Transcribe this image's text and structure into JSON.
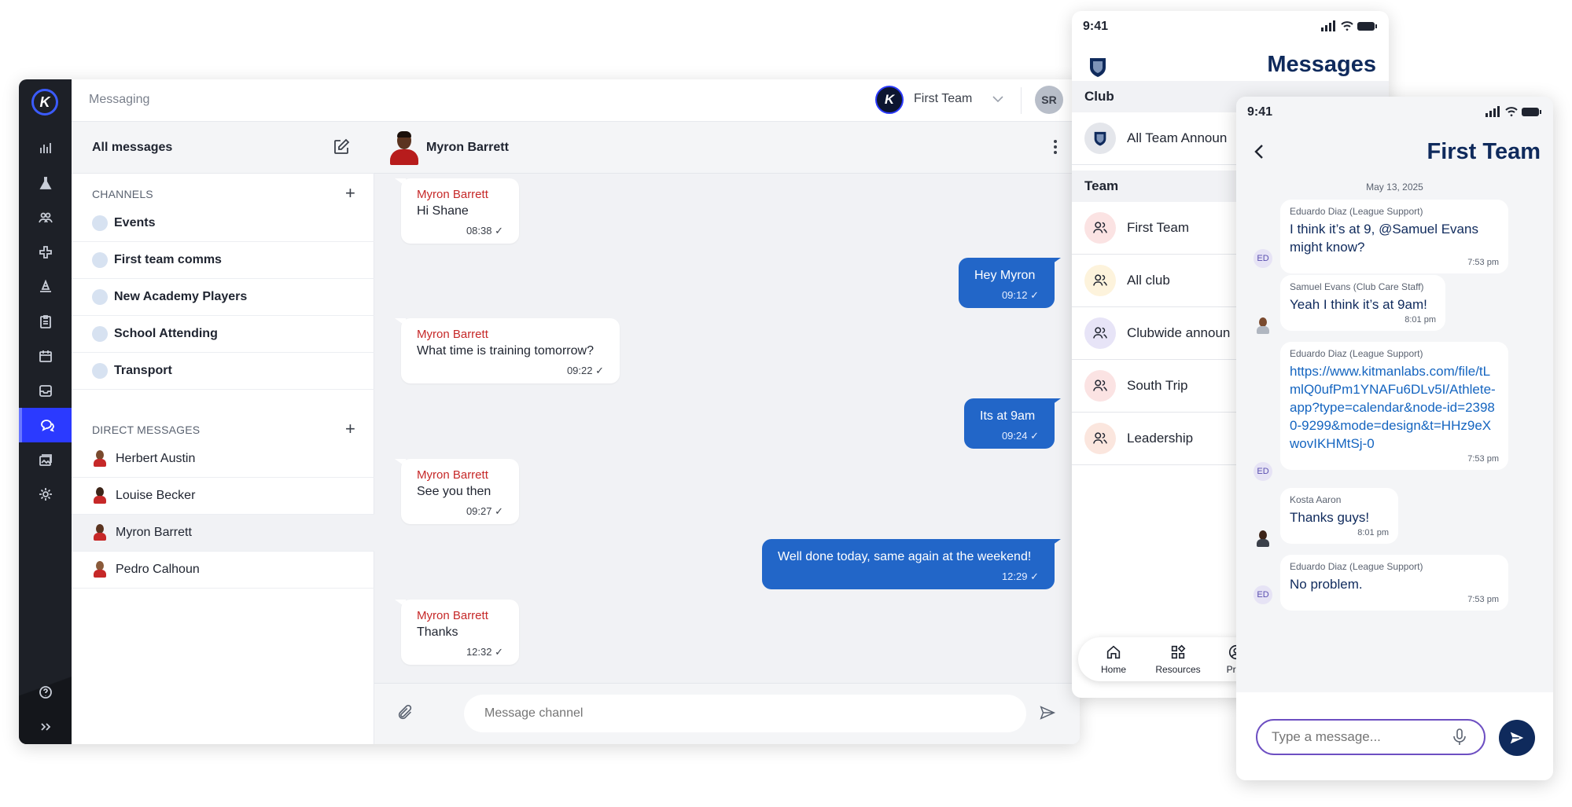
{
  "desktop": {
    "topbar": {
      "title": "Messaging",
      "team_name": "First Team",
      "user_initials": "SR",
      "team_logo_letter": "K"
    },
    "rail_logo_letter": "K",
    "sidebar": {
      "all_messages_label": "All messages",
      "channels_heading": "CHANNELS",
      "channels": [
        {
          "label": "Events"
        },
        {
          "label": "First team comms"
        },
        {
          "label": "New Academy Players"
        },
        {
          "label": "School Attending"
        },
        {
          "label": "Transport"
        }
      ],
      "direct_heading": "DIRECT MESSAGES",
      "direct": [
        {
          "label": "Herbert Austin"
        },
        {
          "label": "Louise Becker"
        },
        {
          "label": "Myron Barrett"
        },
        {
          "label": "Pedro Calhoun"
        }
      ]
    },
    "chat": {
      "contact_name": "Myron Barrett",
      "messages": [
        {
          "dir": "in",
          "sender": "Myron Barrett",
          "text": "Hi Shane",
          "time": "08:38 ✓"
        },
        {
          "dir": "out",
          "text": "Hey Myron",
          "time": "09:12 ✓"
        },
        {
          "dir": "in",
          "sender": "Myron Barrett",
          "text": "What time is training tomorrow?",
          "time": "09:22 ✓"
        },
        {
          "dir": "out",
          "text": "Its at 9am",
          "time": "09:24 ✓"
        },
        {
          "dir": "in",
          "sender": "Myron Barrett",
          "text": "See you then",
          "time": "09:27 ✓"
        },
        {
          "dir": "out",
          "text": "Well done today, same again at the weekend!",
          "time": "12:29 ✓"
        },
        {
          "dir": "in",
          "sender": "Myron Barrett",
          "text": "Thanks",
          "time": "12:32 ✓"
        }
      ],
      "composer_placeholder": "Message channel"
    },
    "colors": {
      "accent": "#2b3aff",
      "outgoing_bubble": "#2266c8",
      "sender_name": "#c62828"
    }
  },
  "phone_messages": {
    "status_time": "9:41",
    "title": "Messages",
    "club_heading": "Club",
    "club_items": [
      {
        "label": "All Team Announ"
      }
    ],
    "team_heading": "Team",
    "team_items": [
      {
        "label": "First Team",
        "color": "#fbe3e3"
      },
      {
        "label": "All club",
        "color": "#fdf3dc"
      },
      {
        "label": "Clubwide announ",
        "color": "#e7e4f7"
      },
      {
        "label": "South Trip",
        "color": "#fbe3e3"
      },
      {
        "label": "Leadership",
        "color": "#fbe6de"
      }
    ],
    "tabs": [
      {
        "label": "Home"
      },
      {
        "label": "Resources"
      },
      {
        "label": "Profi"
      }
    ]
  },
  "phone_chat": {
    "status_time": "9:41",
    "title": "First Team",
    "date": "May 13, 2025",
    "messages": [
      {
        "who": "Eduardo Diaz (League Support)",
        "msg": "I think it’s at 9, @Samuel Evans might know?",
        "time": "7:53 pm",
        "avatar": "ED"
      },
      {
        "who": "Samuel Evans (Club Care Staff)",
        "msg": "Yeah I think it’s at 9am!",
        "time": "8:01 pm"
      },
      {
        "who": "Eduardo Diaz (League Support)",
        "msg": "https://www.kitmanlabs.com/file/tLmlQ0ufPm1YNAFu6DLv5I/Athlete-app?type=calendar&node-id=23980-9299&mode=design&t=HHz9eXwovIKHMtSj-0",
        "time": "7:53 pm",
        "avatar": "ED"
      },
      {
        "who": "Kosta Aaron",
        "msg": "Thanks guys!",
        "time": "8:01 pm"
      },
      {
        "who": "Eduardo Diaz (League Support)",
        "msg": "No problem.",
        "time": "7:53 pm",
        "avatar": "ED"
      }
    ],
    "input_placeholder": "Type a message..."
  }
}
